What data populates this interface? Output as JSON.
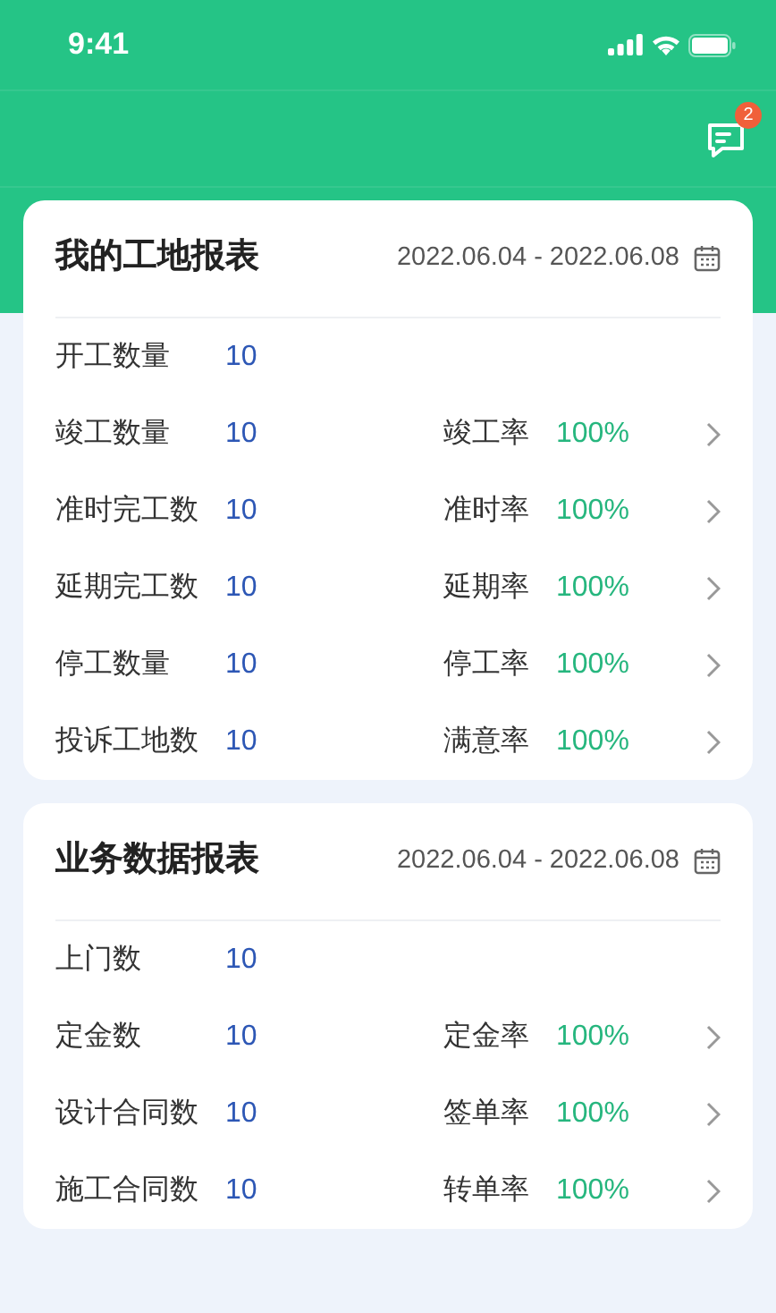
{
  "status_bar": {
    "time": "9:41"
  },
  "header": {
    "message_badge": "2"
  },
  "reports": [
    {
      "title": "我的工地报表",
      "date_range": "2022.06.04 - 2022.06.08",
      "rows": [
        {
          "label": "开工数量",
          "value": "10"
        },
        {
          "label": "竣工数量",
          "value": "10",
          "rate_label": "竣工率",
          "rate": "100%"
        },
        {
          "label": "准时完工数",
          "value": "10",
          "rate_label": "准时率",
          "rate": "100%"
        },
        {
          "label": "延期完工数",
          "value": "10",
          "rate_label": "延期率",
          "rate": "100%"
        },
        {
          "label": "停工数量",
          "value": "10",
          "rate_label": "停工率",
          "rate": "100%"
        },
        {
          "label": "投诉工地数",
          "value": "10",
          "rate_label": "满意率",
          "rate": "100%"
        }
      ]
    },
    {
      "title": "业务数据报表",
      "date_range": "2022.06.04 - 2022.06.08",
      "rows": [
        {
          "label": "上门数",
          "value": "10"
        },
        {
          "label": "定金数",
          "value": "10",
          "rate_label": "定金率",
          "rate": "100%"
        },
        {
          "label": "设计合同数",
          "value": "10",
          "rate_label": "签单率",
          "rate": "100%"
        },
        {
          "label": "施工合同数",
          "value": "10",
          "rate_label": "转单率",
          "rate": "100%"
        }
      ]
    }
  ]
}
